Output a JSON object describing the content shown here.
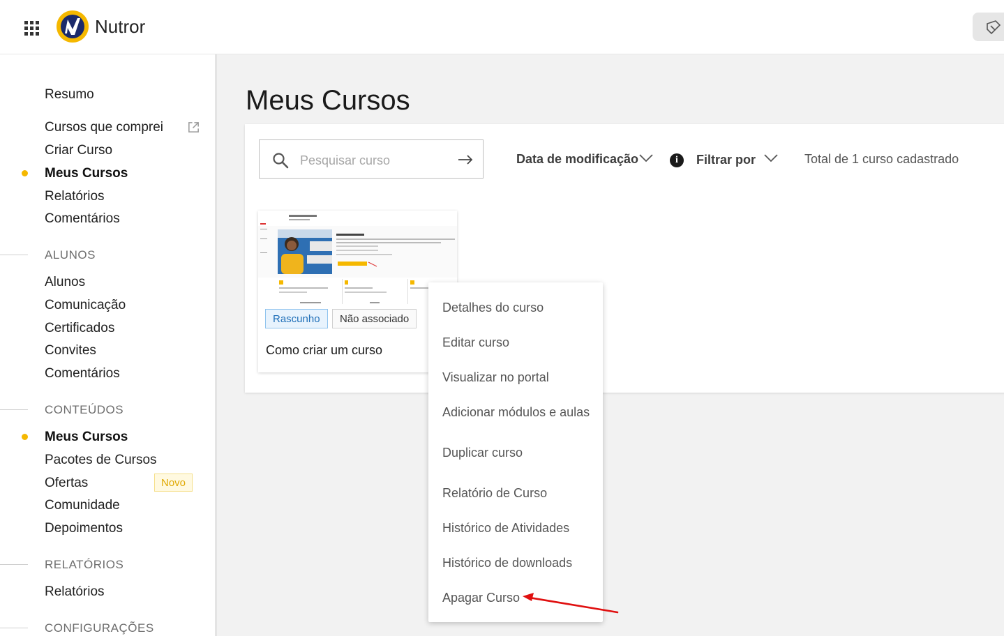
{
  "header": {
    "brand": "Nutror"
  },
  "sidebar": {
    "items_top": [
      {
        "label": "Resumo"
      },
      {
        "label": "Cursos que comprei"
      },
      {
        "label": "Criar Curso"
      },
      {
        "label": "Meus Cursos"
      },
      {
        "label": "Relatórios"
      },
      {
        "label": "Comentários"
      }
    ],
    "sections": [
      {
        "title": "ALUNOS",
        "items": [
          "Alunos",
          "Comunicação",
          "Certificados",
          "Convites",
          "Comentários"
        ]
      },
      {
        "title": "CONTEÚDOS",
        "items": [
          "Meus Cursos",
          "Pacotes de Cursos",
          "Ofertas",
          "Comunidade",
          "Depoimentos"
        ]
      },
      {
        "title": "RELATÓRIOS",
        "items": [
          "Relatórios"
        ]
      },
      {
        "title": "CONFIGURAÇÕES",
        "items": []
      }
    ],
    "new_badge": "Novo",
    "accent_color": "#f5b800"
  },
  "main": {
    "title": "Meus Cursos",
    "search": {
      "placeholder": "Pesquisar curso",
      "value": ""
    },
    "sort_label": "Data de modificação",
    "filter_label": "Filtrar por",
    "total_label": "Total de 1 curso cadastrado"
  },
  "course": {
    "status_tag": "Rascunho",
    "assoc_tag": "Não associado",
    "title": "Como criar um curso"
  },
  "context_menu": {
    "items": [
      "Detalhes do curso",
      "Editar curso",
      "Visualizar no portal",
      "Adicionar módulos e aulas",
      "Duplicar curso",
      "Relatório de Curso",
      "Histórico de Atividades",
      "Histórico de downloads",
      "Apagar Curso"
    ]
  }
}
